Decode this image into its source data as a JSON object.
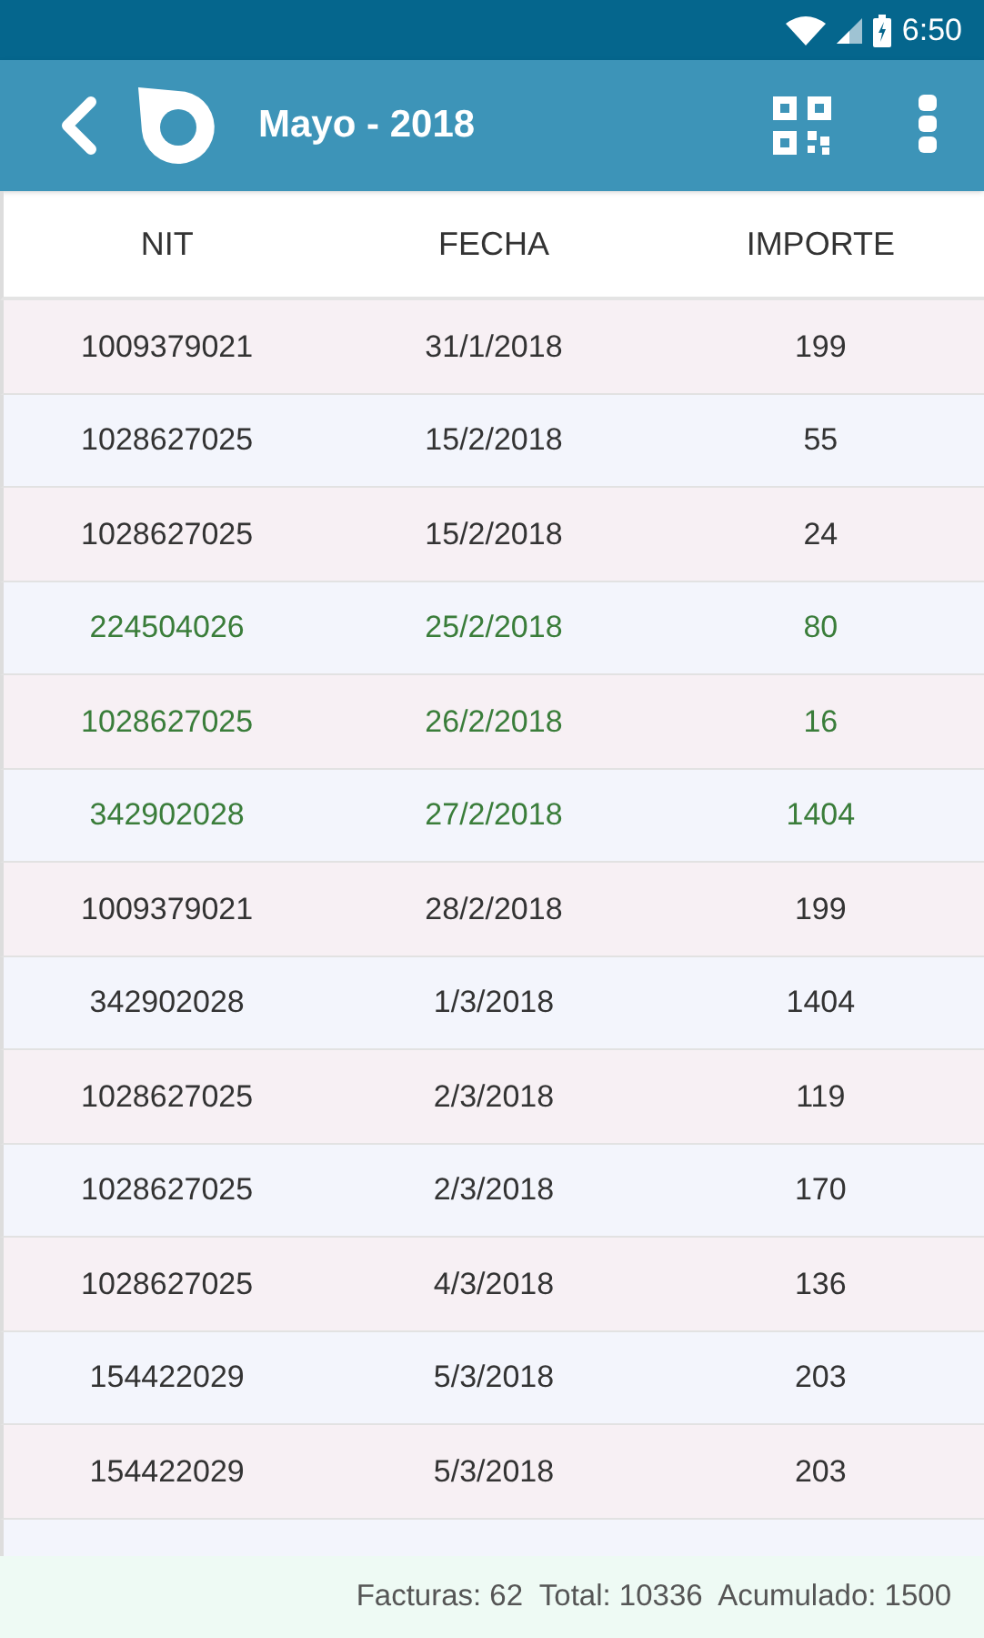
{
  "status_bar": {
    "time": "6:50"
  },
  "app_bar": {
    "title": "Mayo - 2018"
  },
  "table": {
    "columns": [
      "NIT",
      "FECHA",
      "IMPORTE"
    ],
    "rows": [
      {
        "cells": [
          "1009379021",
          "31/1/2018",
          "199"
        ],
        "color": "#333333"
      },
      {
        "cells": [
          "1028627025",
          "15/2/2018",
          "55"
        ],
        "color": "#333333"
      },
      {
        "cells": [
          "1028627025",
          "15/2/2018",
          "24"
        ],
        "color": "#333333"
      },
      {
        "cells": [
          "224504026",
          "25/2/2018",
          "80"
        ],
        "color": "#3a7d3a"
      },
      {
        "cells": [
          "1028627025",
          "26/2/2018",
          "16"
        ],
        "color": "#3a7d3a"
      },
      {
        "cells": [
          "342902028",
          "27/2/2018",
          "1404"
        ],
        "color": "#3a7d3a"
      },
      {
        "cells": [
          "1009379021",
          "28/2/2018",
          "199"
        ],
        "color": "#333333"
      },
      {
        "cells": [
          "342902028",
          "1/3/2018",
          "1404"
        ],
        "color": "#333333"
      },
      {
        "cells": [
          "1028627025",
          "2/3/2018",
          "119"
        ],
        "color": "#333333"
      },
      {
        "cells": [
          "1028627025",
          "2/3/2018",
          "170"
        ],
        "color": "#333333"
      },
      {
        "cells": [
          "1028627025",
          "4/3/2018",
          "136"
        ],
        "color": "#333333"
      },
      {
        "cells": [
          "154422029",
          "5/3/2018",
          "203"
        ],
        "color": "#333333"
      },
      {
        "cells": [
          "154422029",
          "5/3/2018",
          "203"
        ],
        "color": "#333333"
      }
    ]
  },
  "footer": {
    "summary": "Facturas: 62  Total: 10336  Acumulado: 1500"
  }
}
